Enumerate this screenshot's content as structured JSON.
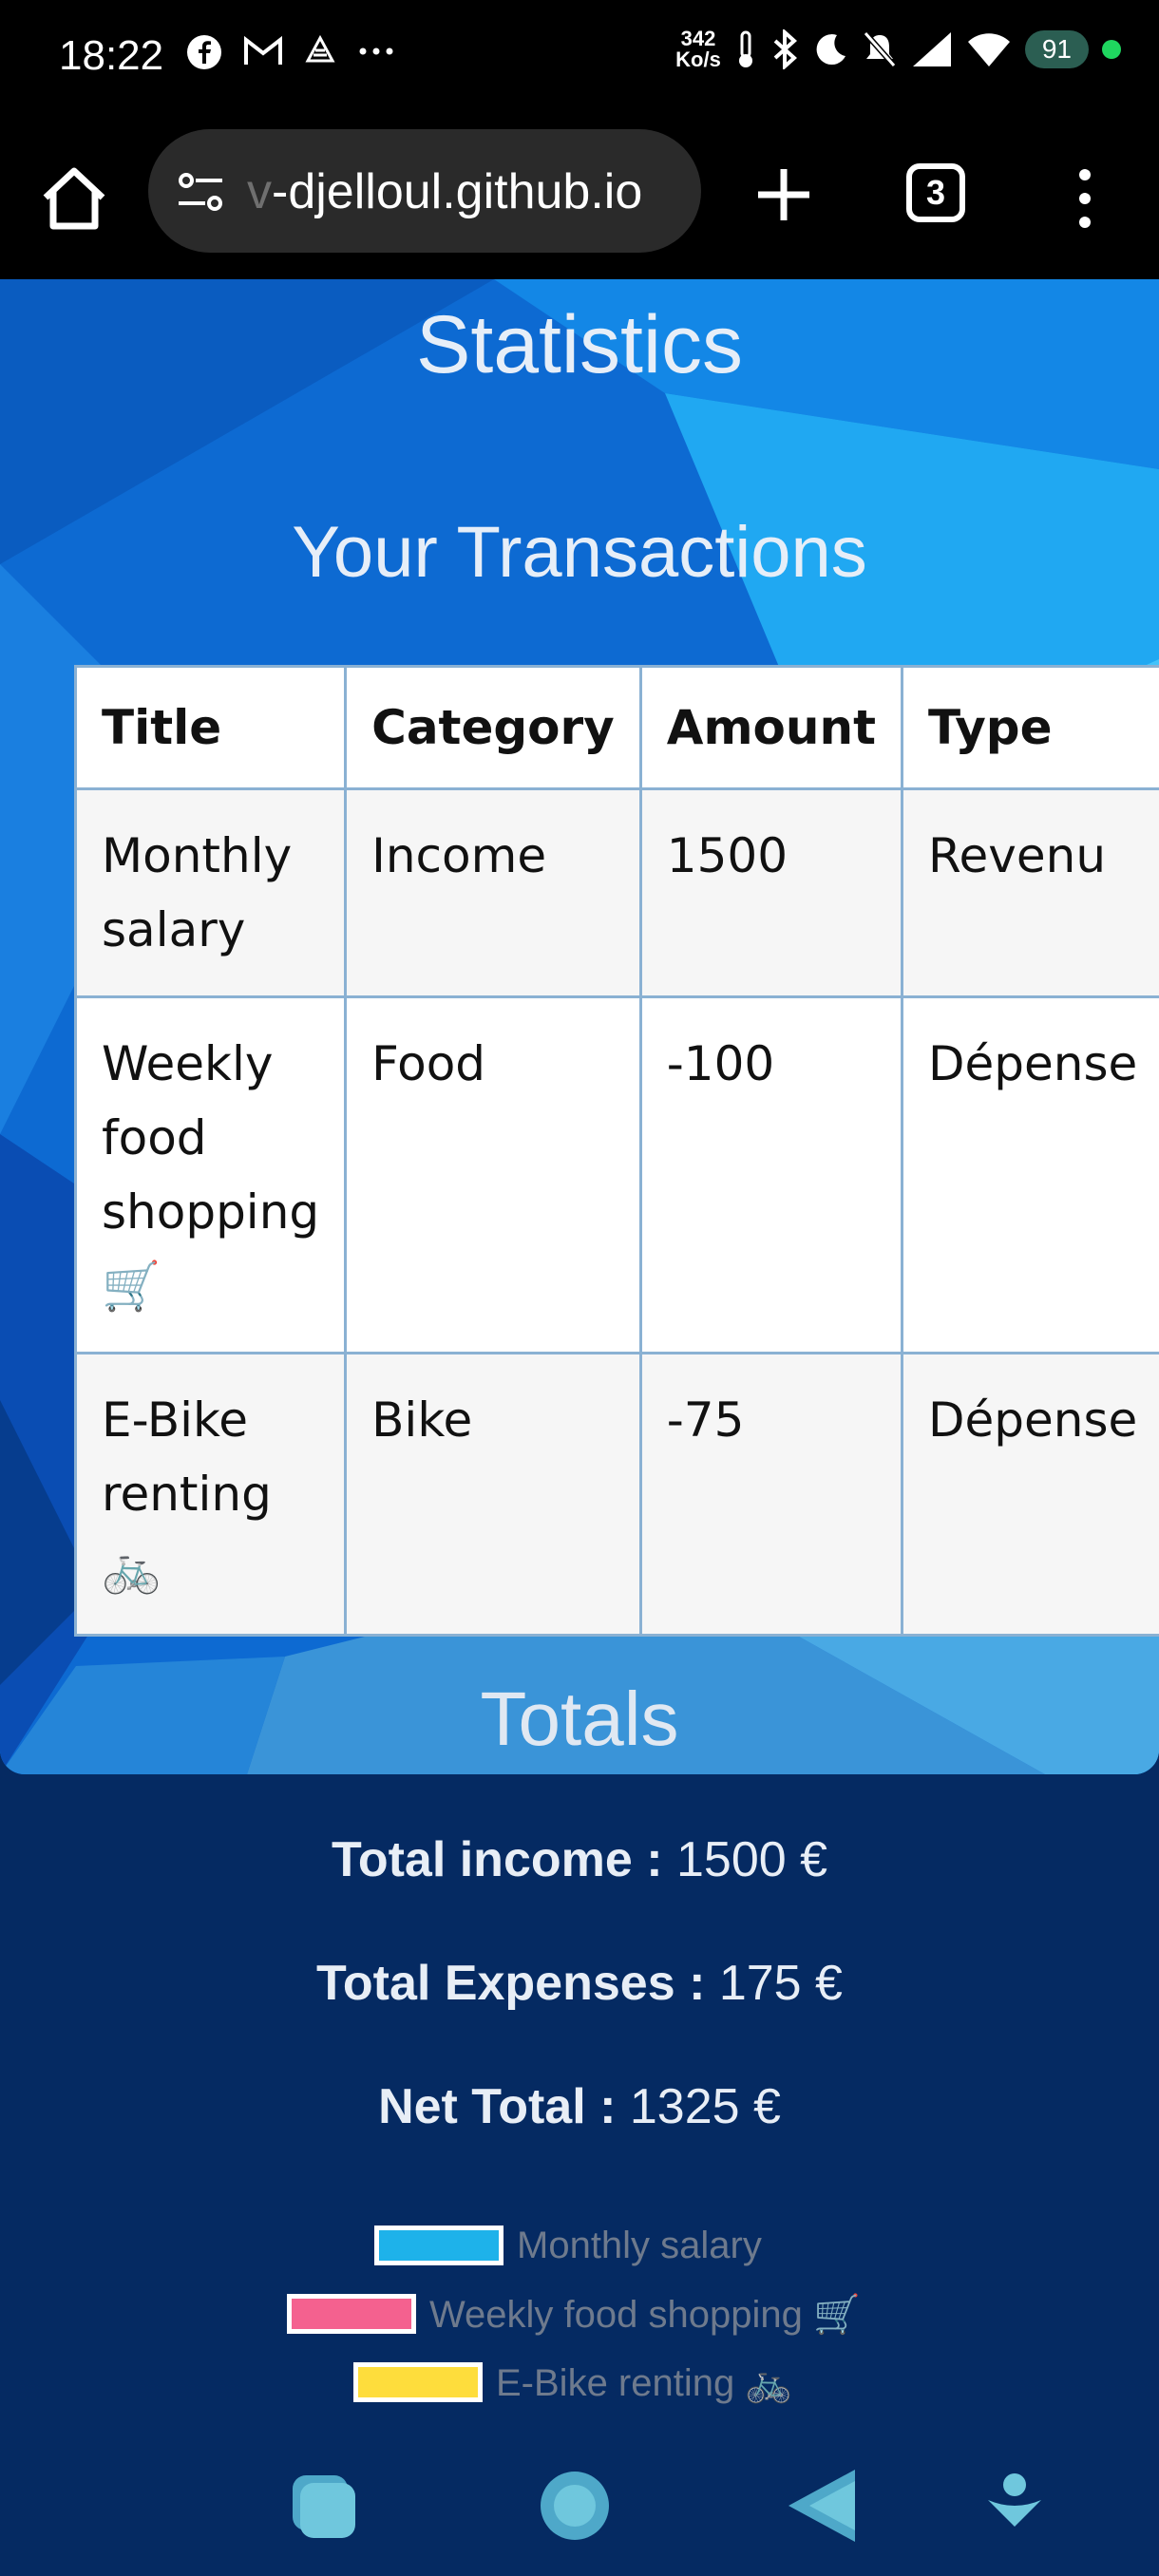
{
  "status_bar": {
    "time": "18:22",
    "net_speed_value": "342",
    "net_speed_unit": "Ko/s",
    "battery": "91"
  },
  "browser": {
    "url_faded": "v",
    "url": "-djelloul.github.io",
    "tab_count": "3"
  },
  "page": {
    "statistics_title": "Statistics",
    "transactions_title": "Your Transactions",
    "table": {
      "headers": [
        "Title",
        "Category",
        "Amount",
        "Type"
      ],
      "rows": [
        [
          "Monthly salary",
          "Income",
          "1500",
          "Revenu"
        ],
        [
          "Weekly food shopping 🛒",
          "Food",
          "-100",
          "Dépense"
        ],
        [
          "E-Bike renting 🚲",
          "Bike",
          "-75",
          "Dépense"
        ]
      ]
    },
    "totals_title": "Totals",
    "totals": {
      "income_label": "Total income :",
      "income_value": "1500 €",
      "expenses_label": "Total Expenses :",
      "expenses_value": "175 €",
      "net_label": "Net Total :",
      "net_value": "1325 €"
    },
    "legend": [
      {
        "label": "Monthly salary",
        "color": "#1eb2ea"
      },
      {
        "label": "Weekly food shopping 🛒",
        "color": "#f4618f"
      },
      {
        "label": "E-Bike renting 🚲",
        "color": "#fedd3c"
      }
    ]
  },
  "colors": {
    "page_bg": "#052a62",
    "accent_nav": "#6fc7dd"
  }
}
